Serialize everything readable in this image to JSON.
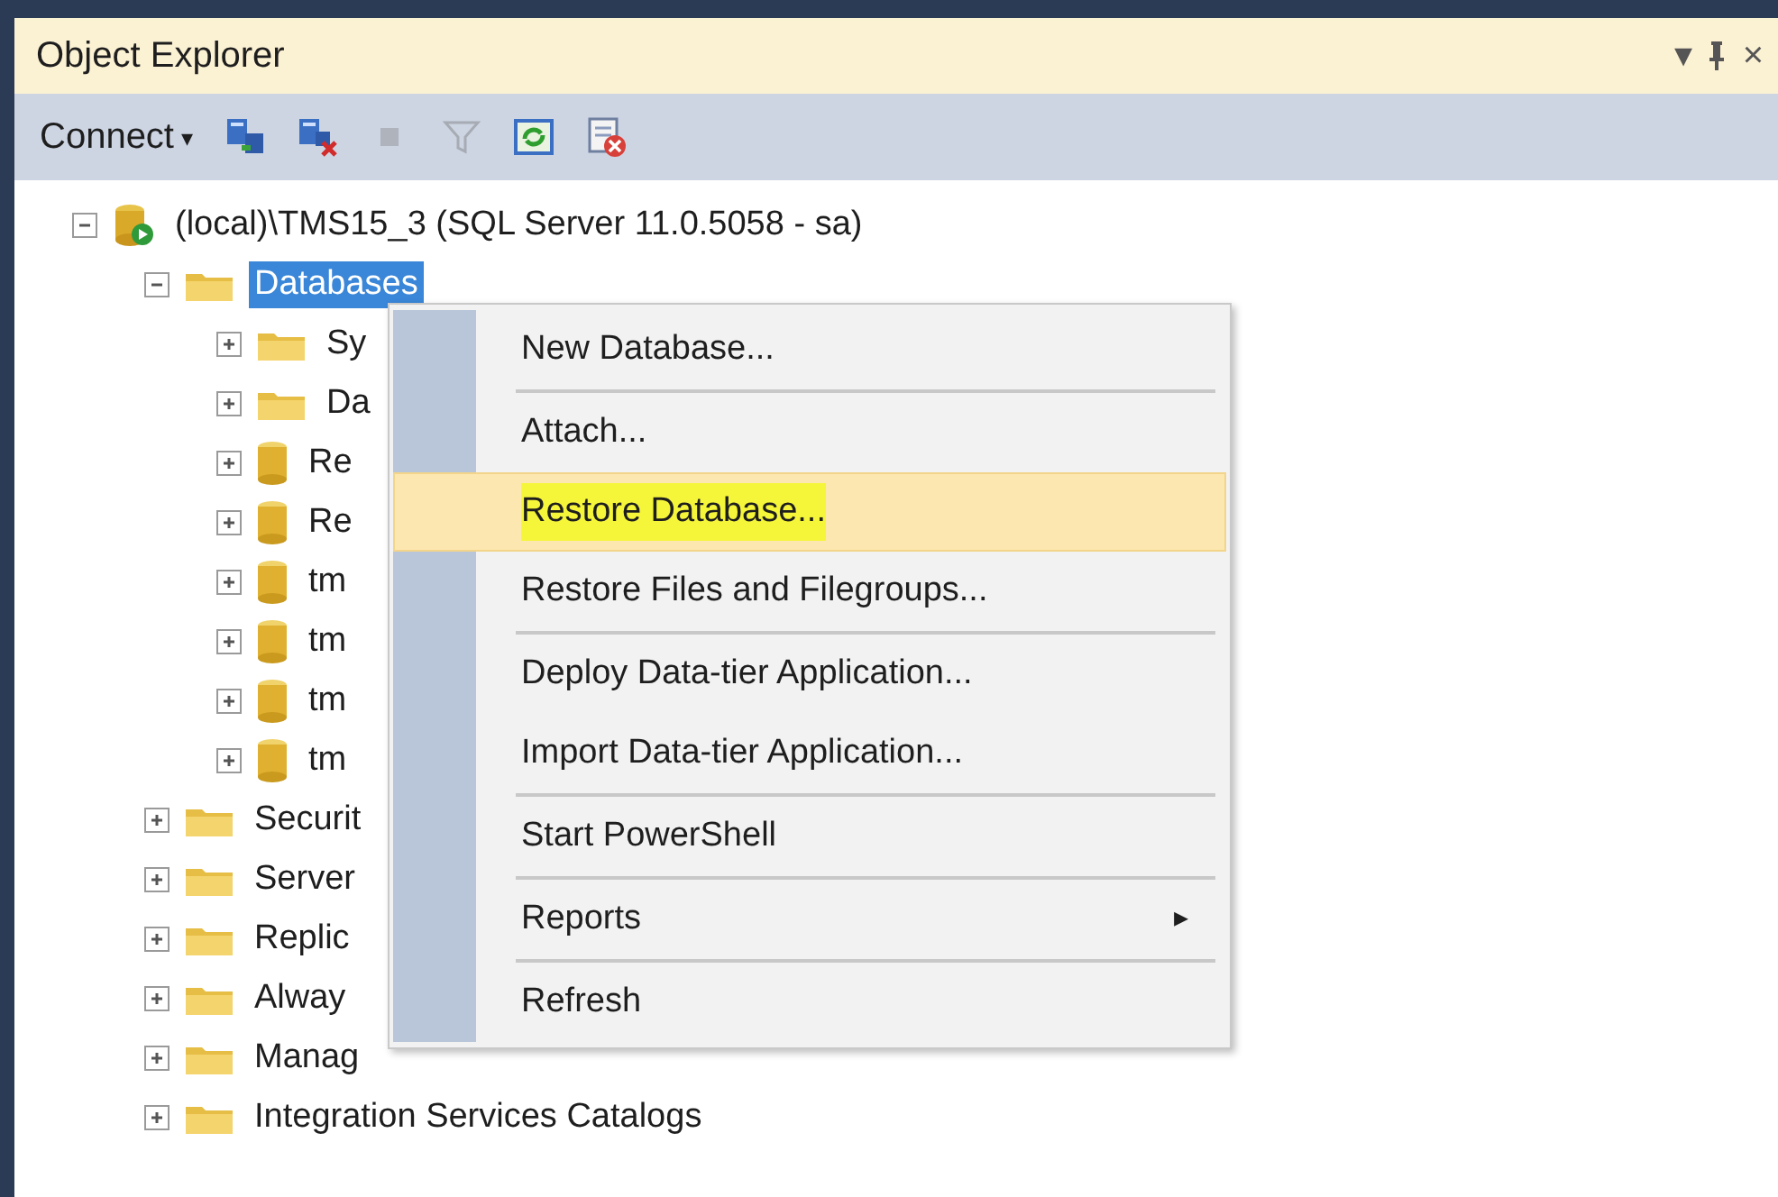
{
  "window": {
    "title": "Object Explorer",
    "buttons": [
      {
        "kind": "dropdown",
        "glyph": "▾"
      },
      {
        "kind": "pin"
      },
      {
        "kind": "close",
        "glyph": "×"
      }
    ]
  },
  "toolbar": {
    "connect": {
      "label": "Connect",
      "caret": "▾"
    },
    "tools": [
      {
        "kind": "connect",
        "disabled": false
      },
      {
        "kind": "disconnect",
        "disabled": false
      },
      {
        "kind": "stop",
        "disabled": true
      },
      {
        "kind": "filter",
        "disabled": true
      },
      {
        "kind": "refresh",
        "disabled": false
      },
      {
        "kind": "activity",
        "disabled": false
      }
    ]
  },
  "tree": [
    {
      "label": "(local)\\TMS15_3 (SQL Server 11.0.5058 - sa)",
      "kind": "server",
      "expanded": true,
      "selected": false,
      "children": [
        {
          "label": "Databases",
          "kind": "folder",
          "expanded": true,
          "selected": true,
          "children": [
            {
              "label": "Sy",
              "kind": "folder",
              "expanded": false,
              "selected": false
            },
            {
              "label": "Da",
              "kind": "folder",
              "expanded": false,
              "selected": false
            },
            {
              "label": "Re",
              "kind": "database",
              "expanded": false,
              "selected": false
            },
            {
              "label": "Re",
              "kind": "database",
              "expanded": false,
              "selected": false
            },
            {
              "label": "tm",
              "kind": "database",
              "expanded": false,
              "selected": false
            },
            {
              "label": "tm",
              "kind": "database",
              "expanded": false,
              "selected": false
            },
            {
              "label": "tm",
              "kind": "database",
              "expanded": false,
              "selected": false
            },
            {
              "label": "tm",
              "kind": "database",
              "expanded": false,
              "selected": false
            }
          ]
        },
        {
          "label": "Securit",
          "kind": "folder",
          "expanded": false,
          "selected": false
        },
        {
          "label": "Server",
          "kind": "folder",
          "expanded": false,
          "selected": false
        },
        {
          "label": "Replic",
          "kind": "folder",
          "expanded": false,
          "selected": false
        },
        {
          "label": "Alway",
          "kind": "folder",
          "expanded": false,
          "selected": false
        },
        {
          "label": "Manag",
          "kind": "folder",
          "expanded": false,
          "selected": false
        },
        {
          "label": "Integration Services Catalogs",
          "kind": "folder",
          "expanded": false,
          "selected": false
        }
      ]
    }
  ],
  "context_menu": {
    "groups": [
      [
        {
          "label": "New Database...",
          "selected": false,
          "marked": false
        }
      ],
      [
        {
          "label": "Attach...",
          "selected": false,
          "marked": false
        },
        {
          "label": "Restore Database...",
          "selected": true,
          "marked": true
        },
        {
          "label": "Restore Files and Filegroups...",
          "selected": false,
          "marked": false
        }
      ],
      [
        {
          "label": "Deploy Data-tier Application...",
          "selected": false,
          "marked": false
        },
        {
          "label": "Import Data-tier Application...",
          "selected": false,
          "marked": false
        }
      ],
      [
        {
          "label": "Start PowerShell",
          "selected": false,
          "marked": false
        }
      ],
      [
        {
          "label": "Reports",
          "selected": false,
          "marked": false,
          "submenu_arrow": "▸"
        }
      ],
      [
        {
          "label": "Refresh",
          "selected": false,
          "marked": false
        }
      ]
    ]
  }
}
